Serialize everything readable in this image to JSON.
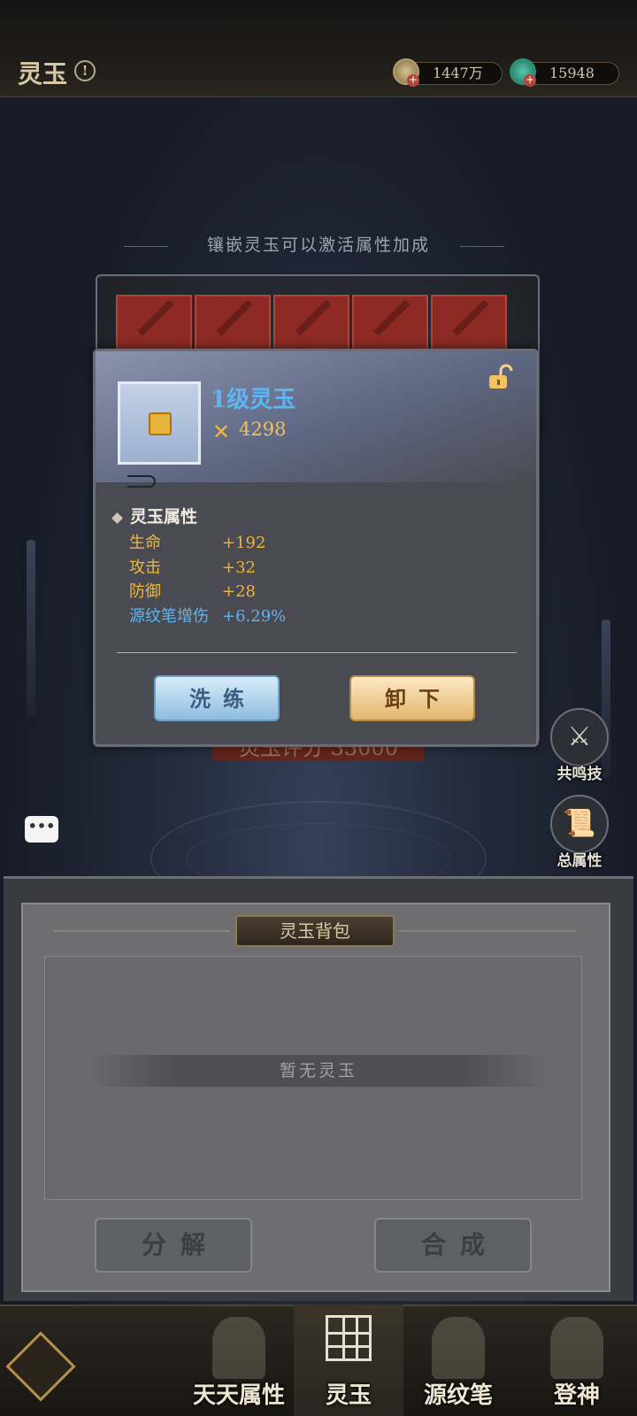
{
  "header": {
    "title": "灵玉",
    "info_icon": "info-icon",
    "currencies": [
      {
        "icon": "coin-icon",
        "value": "1447万"
      },
      {
        "icon": "jade-icon",
        "value": "15948"
      }
    ]
  },
  "main": {
    "hint": "镶嵌灵玉可以激活属性加成",
    "score_text": "灵玉评分 33000"
  },
  "popup": {
    "item_name": "1级灵玉",
    "power": "4298",
    "lock_icon": "unlock-icon",
    "attr_title": "灵玉属性",
    "attributes": [
      {
        "name": "生命",
        "value": "+192",
        "color": "#efb53e"
      },
      {
        "name": "攻击",
        "value": "+32",
        "color": "#efb53e"
      },
      {
        "name": "防御",
        "value": "+28",
        "color": "#efb53e"
      },
      {
        "name": "源纹笔增伤",
        "value": "+6.29%",
        "color": "#5fb4f4"
      }
    ],
    "refine_label": "洗练",
    "unequip_label": "卸下"
  },
  "side": {
    "resonance_label": "共鸣技",
    "total_attr_label": "总属性",
    "chat_icon": "chat-icon"
  },
  "bag": {
    "title": "灵玉背包",
    "empty_text": "暂无灵玉",
    "decompose_label": "分解",
    "synthesize_label": "合成"
  },
  "nav": {
    "home_icon": "home-icon",
    "items": [
      {
        "label": "天天属性",
        "active": false
      },
      {
        "label": "灵玉",
        "active": true
      },
      {
        "label": "源纹笔",
        "active": false
      },
      {
        "label": "登神",
        "active": false
      }
    ]
  }
}
